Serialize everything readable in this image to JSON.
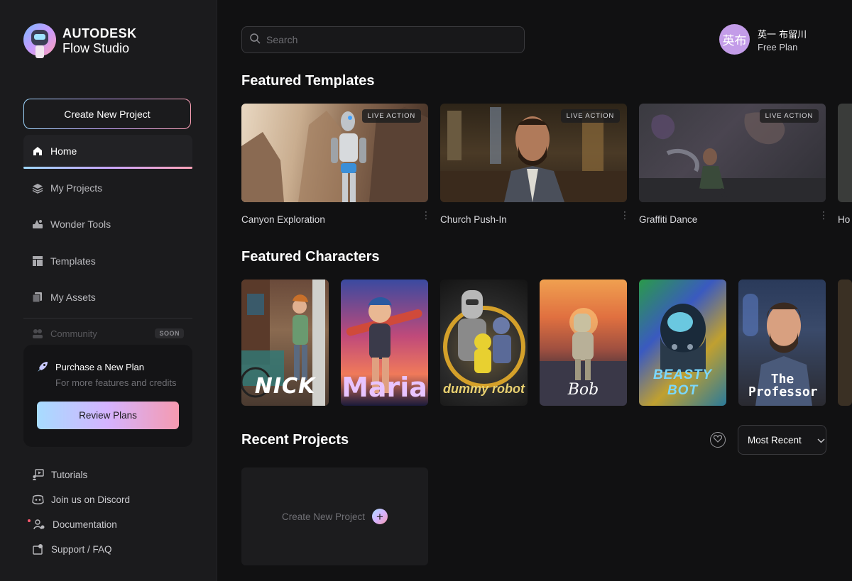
{
  "brand": {
    "line1": "AUTODESK",
    "line2": "Flow Studio"
  },
  "sidebar": {
    "create_label": "Create New Project",
    "items": [
      {
        "label": "Home",
        "icon": "home-icon",
        "active": true
      },
      {
        "label": "My Projects",
        "icon": "layers-icon"
      },
      {
        "label": "Wonder Tools",
        "icon": "tools-icon"
      },
      {
        "label": "Templates",
        "icon": "templates-icon"
      },
      {
        "label": "My Assets",
        "icon": "assets-icon"
      }
    ],
    "community": {
      "label": "Community",
      "badge": "SOON"
    },
    "plan": {
      "title": "Purchase a New Plan",
      "subtitle": "For more features and credits",
      "button": "Review Plans"
    },
    "footer": [
      {
        "label": "Tutorials",
        "icon": "tutorials-icon"
      },
      {
        "label": "Join us on Discord",
        "icon": "discord-icon"
      },
      {
        "label": "Documentation",
        "icon": "documentation-icon"
      },
      {
        "label": "Support / FAQ",
        "icon": "support-icon"
      }
    ]
  },
  "search": {
    "placeholder": "Search"
  },
  "user": {
    "initials": "英布",
    "name": "英一 布留川",
    "plan": "Free Plan"
  },
  "sections": {
    "templates_title": "Featured Templates",
    "characters_title": "Featured Characters",
    "recent_title": "Recent Projects"
  },
  "templates": [
    {
      "name": "Canyon Exploration",
      "badge": "LIVE ACTION"
    },
    {
      "name": "Church Push-In",
      "badge": "LIVE ACTION"
    },
    {
      "name": "Graffiti Dance",
      "badge": "LIVE ACTION"
    },
    {
      "name": "Ho",
      "badge": ""
    }
  ],
  "characters": [
    {
      "label": "NICK"
    },
    {
      "label": "Maria"
    },
    {
      "label": "dummy robot"
    },
    {
      "label": "Bob"
    },
    {
      "label": "BEASTY BOT"
    },
    {
      "label": "The Professor"
    }
  ],
  "recent": {
    "sort_value": "Most Recent",
    "new_project_label": "Create New Project"
  },
  "colors": {
    "accent_start": "#a7dcff",
    "accent_mid": "#d5b3ff",
    "accent_end": "#f59ab0",
    "avatar": "#c39ce8"
  }
}
